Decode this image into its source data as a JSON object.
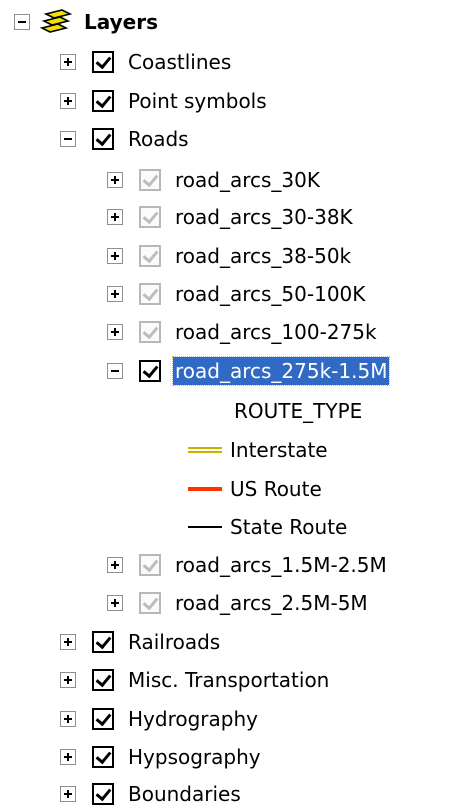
{
  "root": {
    "label": "Layers",
    "icon": "layers-icon",
    "icon_color": "#f2e000"
  },
  "layers": [
    {
      "label": "Coastlines"
    },
    {
      "label": "Point symbols"
    },
    {
      "label": "Roads"
    },
    {
      "label": "Railroads"
    },
    {
      "label": "Misc. Transportation"
    },
    {
      "label": "Hydrography"
    },
    {
      "label": "Hypsography"
    },
    {
      "label": "Boundaries"
    }
  ],
  "road_sublayers": [
    {
      "label": "road_arcs_30K"
    },
    {
      "label": "road_arcs_30-38K"
    },
    {
      "label": "road_arcs_38-50k"
    },
    {
      "label": "road_arcs_50-100K"
    },
    {
      "label": "road_arcs_100-275k"
    },
    {
      "label": "road_arcs_275k-1.5M",
      "selected": true
    },
    {
      "label": "road_arcs_1.5M-2.5M"
    },
    {
      "label": "road_arcs_2.5M-5M"
    }
  ],
  "legend": {
    "heading": "ROUTE_TYPE",
    "items": [
      {
        "label": "Interstate",
        "color": "#c8b400"
      },
      {
        "label": "US Route",
        "color": "#ff3300"
      },
      {
        "label": "State Route",
        "color": "#000000"
      }
    ]
  },
  "colors": {
    "selection_bg": "#316ac5",
    "selection_border": "#f0c000",
    "disabled_check": "#bdbdbd"
  }
}
